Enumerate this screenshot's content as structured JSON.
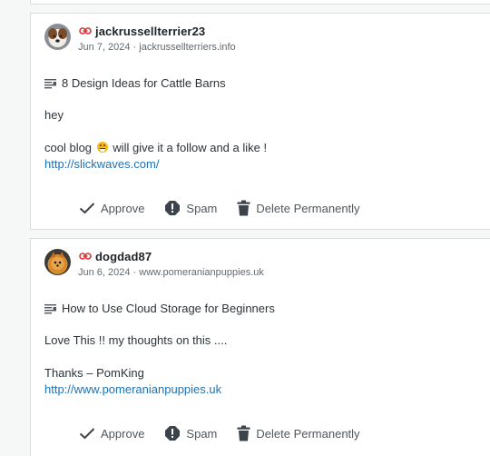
{
  "comments": [
    {
      "author": "jackrussellterrier23",
      "date": "Jun 7, 2024",
      "site": "jackrussellterriers.info",
      "post_title": "8 Design Ideas for Cattle Barns",
      "line1": "hey",
      "line2a": "cool blog",
      "line2b": "will give it a follow and a like !",
      "link": "http://slickwaves.com/"
    },
    {
      "author": "dogdad87",
      "date": "Jun 6, 2024",
      "site": "www.pomeranianpuppies.uk",
      "post_title": "How to Use Cloud Storage for Beginners",
      "line1": "Love This !! my thoughts on this ....",
      "line2": "Thanks – PomKing",
      "link": "http://www.pomeranianpuppies.uk"
    }
  ],
  "actions": {
    "approve": "Approve",
    "spam": "Spam",
    "delete": "Delete Permanently"
  },
  "meta_separator": " · ",
  "icons": [
    "link-icon",
    "post-icon",
    "checkmark-icon",
    "spam-icon",
    "trash-icon"
  ],
  "colors": {
    "link": "#2271b1",
    "author_link_icon": "#d63638",
    "text": "#2c3338",
    "muted": "#646970"
  }
}
